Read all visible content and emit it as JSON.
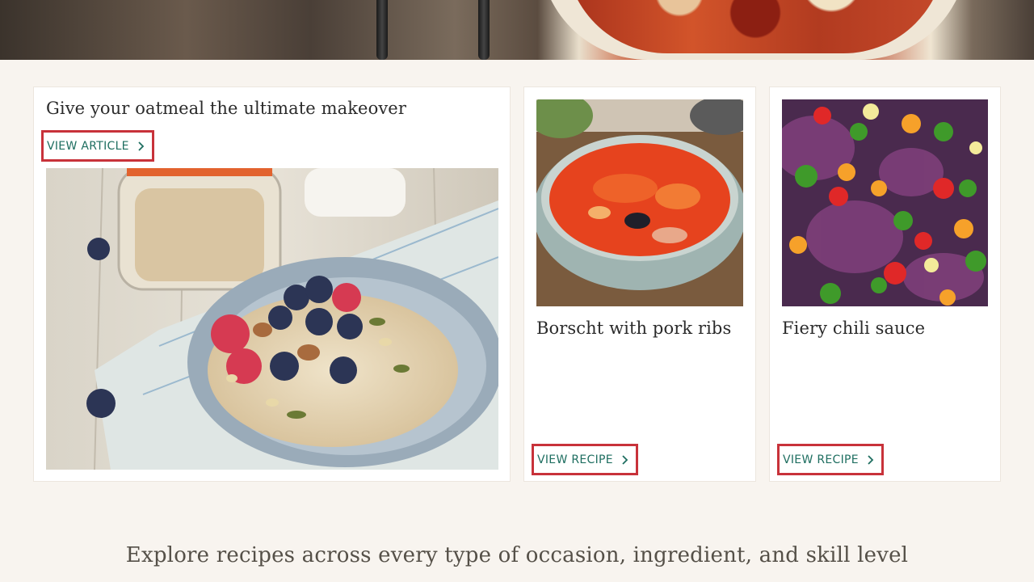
{
  "cards": [
    {
      "title": "Give your oatmeal the ultimate makeover",
      "cta_label": "VIEW ARTICLE"
    },
    {
      "title": "Borscht with pork ribs",
      "cta_label": "VIEW RECIPE"
    },
    {
      "title": "Fiery chili sauce",
      "cta_label": "VIEW RECIPE"
    }
  ],
  "explore_headline": "Explore recipes across every type of occasion, ingredient, and skill level",
  "colors": {
    "page_background": "#f8f4ef",
    "link_text": "#1e6e60",
    "highlight_border": "#c8323a",
    "title_text": "#2b2b2b"
  },
  "icons": [
    "chevron-right-icon"
  ]
}
